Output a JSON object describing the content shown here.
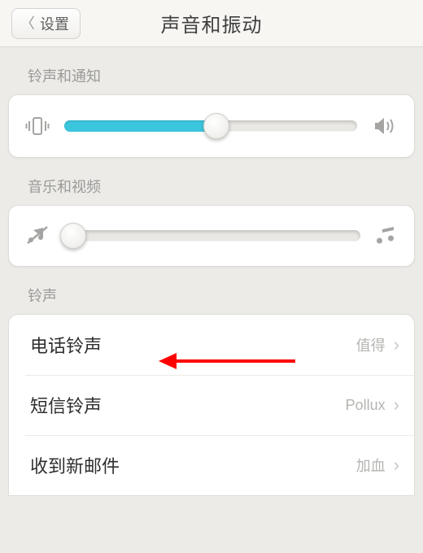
{
  "navbar": {
    "back_label": "设置",
    "title": "声音和振动"
  },
  "sections": {
    "ringtone_notifications": {
      "label": "铃声和通知",
      "slider_percent": 52
    },
    "music_video": {
      "label": "音乐和视频",
      "slider_percent": 3
    },
    "ringtones": {
      "label": "铃声",
      "rows": [
        {
          "title": "电话铃声",
          "value": "值得"
        },
        {
          "title": "短信铃声",
          "value": "Pollux"
        },
        {
          "title": "收到新邮件",
          "value": "加血"
        }
      ]
    }
  },
  "annotation": {
    "arrow_target": "phone-ringtone-row",
    "color": "#ff0000"
  }
}
